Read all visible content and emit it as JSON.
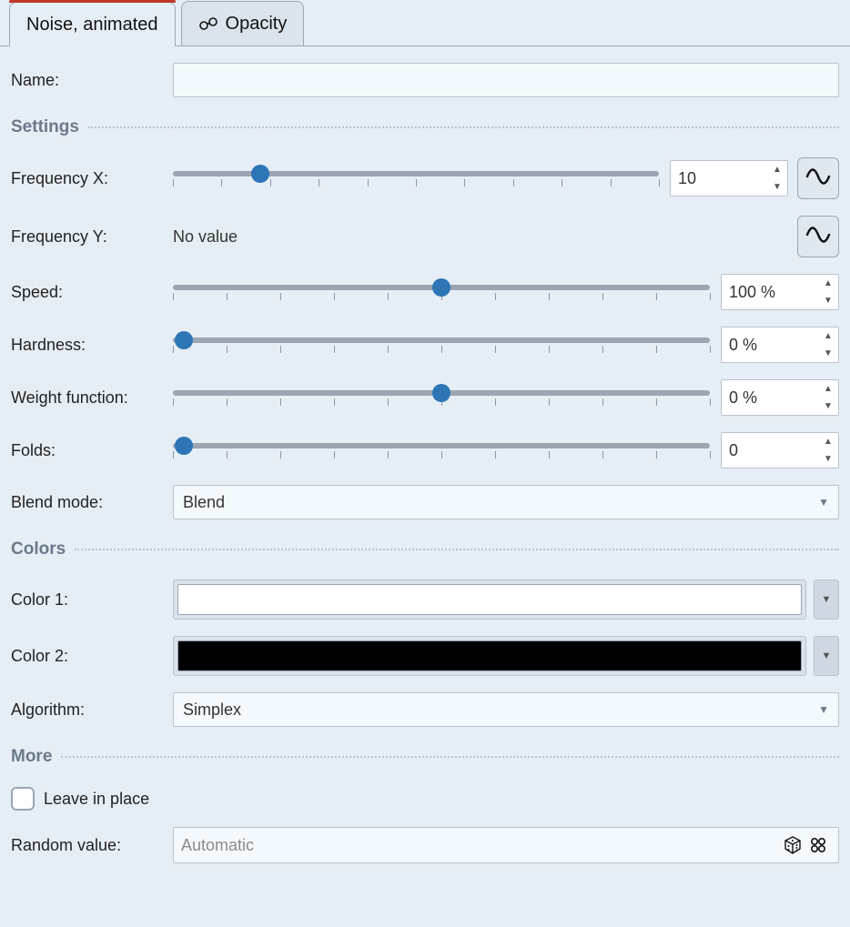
{
  "tabs": {
    "noise": "Noise, animated",
    "opacity": "Opacity"
  },
  "name": {
    "label": "Name:",
    "value": ""
  },
  "sections": {
    "settings": "Settings",
    "colors": "Colors",
    "more": "More"
  },
  "settings": {
    "frequency_x": {
      "label": "Frequency X:",
      "value": "10",
      "slider_pct": 18
    },
    "frequency_y": {
      "label": "Frequency Y:",
      "novalue": "No value"
    },
    "speed": {
      "label": "Speed:",
      "value": "100 %",
      "slider_pct": 50
    },
    "hardness": {
      "label": "Hardness:",
      "value": "0 %",
      "slider_pct": 2
    },
    "weight_fn": {
      "label": "Weight function:",
      "value": "0 %",
      "slider_pct": 50
    },
    "folds": {
      "label": "Folds:",
      "value": "0",
      "slider_pct": 2
    },
    "blend_mode": {
      "label": "Blend mode:",
      "value": "Blend"
    }
  },
  "colors": {
    "color1": {
      "label": "Color 1:",
      "hex": "#ffffff"
    },
    "color2": {
      "label": "Color 2:",
      "hex": "#000000"
    },
    "algorithm": {
      "label": "Algorithm:",
      "value": "Simplex"
    }
  },
  "more": {
    "leave_in_place": {
      "label": "Leave in place",
      "checked": false
    },
    "random_value": {
      "label": "Random value:",
      "placeholder": "Automatic"
    }
  }
}
